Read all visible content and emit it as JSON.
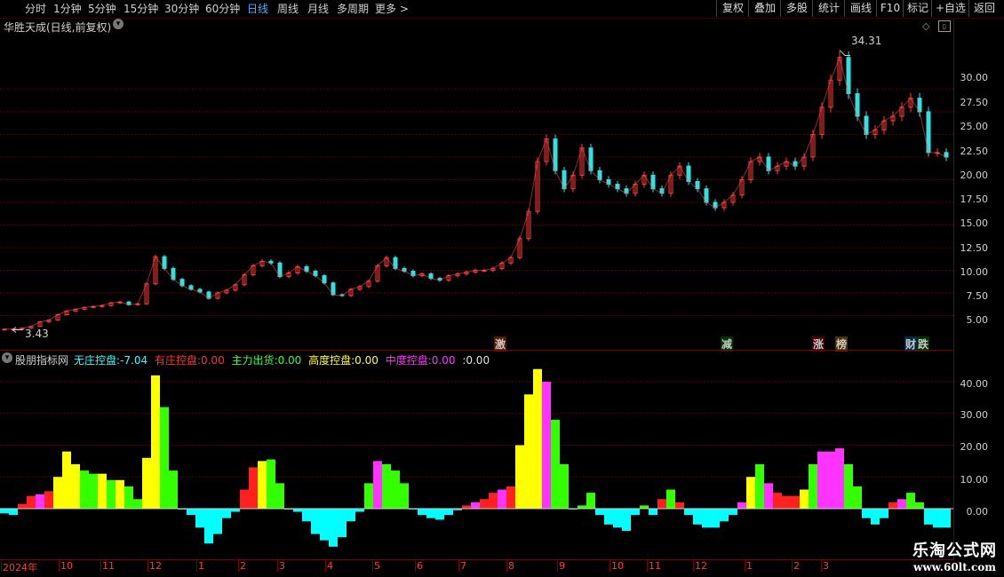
{
  "toolbar": {
    "periods": [
      "分时",
      "1分钟",
      "5分钟",
      "15分钟",
      "30分钟",
      "60分钟",
      "日线",
      "周线",
      "月线",
      "多周期",
      "更多 >"
    ],
    "active_period": "日线",
    "buttons": [
      "复权",
      "叠加",
      "多股",
      "统计",
      "画线",
      "F10",
      "标记",
      "+自选",
      "返回"
    ]
  },
  "main_chart": {
    "title": "华胜天成(日线,前复权)",
    "high_label": "34.31",
    "low_label": "3.43",
    "events": [
      {
        "text": "激",
        "color": "#ff6a00"
      },
      {
        "text": "减",
        "color": "#33ff33"
      },
      {
        "text": "涨",
        "color": "#ff3333"
      },
      {
        "text": "榜",
        "color": "#ffcc33"
      },
      {
        "text": "财",
        "color": "#33aaff"
      },
      {
        "text": "跌",
        "color": "#33ff33"
      }
    ],
    "y_ticks": [
      "30.00",
      "27.50",
      "25.00",
      "22.50",
      "20.00",
      "17.50",
      "15.00",
      "12.50",
      "10.00",
      "7.50",
      "5.00"
    ]
  },
  "indicator": {
    "name": "股朋指标网",
    "items": [
      {
        "label": "无庄控盘:",
        "value": "-7.04",
        "color": "#33ffff"
      },
      {
        "label": "有庄控盘:",
        "value": "0.00",
        "color": "#ff3333"
      },
      {
        "label": "主力出货:",
        "value": "0.00",
        "color": "#33ff33"
      },
      {
        "label": "高度控盘:",
        "value": "0.00",
        "color": "#ffff33"
      },
      {
        "label": "中度控盘:",
        "value": "0.00",
        "color": "#ff33ff"
      },
      {
        "label": ":",
        "value": "0.00",
        "color": "#e0e0e0"
      }
    ],
    "y_ticks": [
      "40.00",
      "30.00",
      "20.00",
      "10.00",
      "0.00"
    ]
  },
  "x_axis": {
    "labels": [
      "2024年",
      "10",
      "11",
      "12",
      "1",
      "2",
      "3",
      "4",
      "5",
      "6",
      "7",
      "8",
      "9",
      "10",
      "11",
      "12",
      "1",
      "2",
      "3"
    ]
  },
  "watermark": {
    "line1": "乐淘公式网",
    "line2": "www.60lt.com"
  },
  "chart_data": [
    {
      "type": "line",
      "title": "华胜天成(日线,前复权)",
      "ylim": [
        2.5,
        37
      ],
      "x": [
        0,
        10,
        20,
        30,
        40,
        50,
        60,
        70,
        80,
        90,
        100,
        110,
        120,
        130,
        140,
        150,
        160,
        170,
        180,
        190,
        200,
        210,
        220,
        230,
        240,
        250,
        260,
        270,
        280,
        290,
        300,
        310,
        320,
        330,
        340,
        350,
        360,
        370,
        380,
        390,
        400,
        410,
        420,
        430,
        440,
        450,
        460,
        470,
        480,
        490,
        500,
        510,
        520,
        530,
        540,
        550,
        560,
        570,
        580,
        590,
        600,
        610,
        620,
        630,
        640,
        650,
        660,
        670,
        680,
        690,
        700,
        710,
        720,
        730,
        740,
        750,
        760,
        770,
        780,
        790,
        800,
        810,
        820,
        830,
        840,
        850,
        860,
        870,
        880,
        890,
        900,
        910,
        920,
        930,
        940,
        950,
        960,
        970,
        980,
        990,
        1000,
        1010,
        1020,
        1030,
        1040,
        1050,
        1060
      ],
      "values": [
        3.5,
        3.5,
        3.6,
        3.8,
        4.3,
        4.5,
        5.1,
        5.5,
        5.7,
        5.9,
        6.0,
        6.1,
        6.4,
        6.5,
        6.2,
        6.3,
        8.5,
        11.5,
        10.2,
        9.0,
        8.3,
        7.9,
        7.6,
        6.9,
        7.5,
        7.8,
        8.4,
        9.5,
        10.5,
        11.0,
        10.8,
        9.3,
        9.7,
        10.4,
        9.9,
        9.4,
        8.6,
        7.3,
        7.2,
        7.9,
        8.2,
        8.8,
        10.5,
        11.4,
        10.2,
        9.9,
        9.4,
        9.6,
        9.1,
        8.9,
        9.4,
        9.6,
        9.8,
        10.0,
        10.0,
        10.2,
        10.8,
        11.4,
        13.5,
        16.5,
        22.0,
        24.5,
        21.0,
        19.0,
        20.5,
        23.5,
        21.0,
        20.0,
        19.5,
        19.0,
        18.5,
        19.5,
        20.5,
        19.0,
        18.5,
        20.5,
        21.5,
        19.8,
        19.0,
        17.5,
        16.9,
        17.5,
        18.3,
        20.0,
        22.0,
        22.5,
        21.0,
        21.5,
        22.0,
        21.5,
        22.5,
        25.0,
        28.0,
        31.0,
        33.5,
        29.5,
        27.0,
        25.0,
        25.5,
        26.5,
        27.0,
        28.0,
        29.0,
        27.5,
        23.0,
        23.0,
        22.5
      ],
      "high": 34.31,
      "low": 3.43,
      "y_ticks": [
        30,
        27.5,
        25,
        22.5,
        20,
        17.5,
        15,
        12.5,
        10,
        7.5,
        5
      ]
    },
    {
      "type": "bar",
      "title": "股朋指标网",
      "ylim": [
        -14,
        47
      ],
      "x": [
        0,
        10,
        20,
        30,
        40,
        50,
        60,
        70,
        80,
        90,
        100,
        110,
        120,
        130,
        140,
        150,
        160,
        170,
        180,
        190,
        200,
        210,
        220,
        230,
        240,
        250,
        260,
        270,
        280,
        290,
        300,
        310,
        320,
        330,
        340,
        350,
        360,
        370,
        380,
        390,
        400,
        410,
        420,
        430,
        440,
        450,
        460,
        470,
        480,
        490,
        500,
        510,
        520,
        530,
        540,
        550,
        560,
        570,
        580,
        590,
        600,
        610,
        620,
        630,
        640,
        650,
        660,
        670,
        680,
        690,
        700,
        710,
        720,
        730,
        740,
        750,
        760,
        770,
        780,
        790,
        800,
        810,
        820,
        830,
        840,
        850,
        860,
        870,
        880,
        890,
        900,
        910,
        920,
        930,
        940,
        950,
        960,
        970,
        980,
        990,
        1000,
        1010,
        1020,
        1030,
        1040,
        1050,
        1060
      ],
      "values": [
        -1.5,
        -2.0,
        1.5,
        4.0,
        4.5,
        5.5,
        10.0,
        18.0,
        14.0,
        12.0,
        11.0,
        11.0,
        9.0,
        9.0,
        7.0,
        3.0,
        16.0,
        42.0,
        32.0,
        12.0,
        0,
        -2.0,
        -6.0,
        -11.0,
        -8.0,
        -3.0,
        -1.0,
        6.0,
        13.0,
        15.0,
        15.5,
        8.0,
        0,
        -1.0,
        -4.0,
        -8.0,
        -10.0,
        -12.0,
        -9.0,
        -4.0,
        -1.0,
        8.0,
        15.0,
        14.0,
        12.0,
        8.0,
        0,
        -2.0,
        -3.0,
        -3.5,
        -2.0,
        -0.5,
        1.0,
        2.0,
        3.0,
        5.0,
        6.0,
        7.0,
        20.0,
        36.0,
        44.0,
        40.0,
        28.0,
        14.0,
        0,
        1.0,
        5.0,
        -2.0,
        -5.0,
        -6.0,
        -7.0,
        -2.0,
        1.0,
        -2.0,
        3.0,
        6.0,
        2.0,
        -2.0,
        -5.0,
        -6.0,
        -6.0,
        -4.0,
        -2.0,
        2.0,
        10.0,
        14.0,
        8.0,
        5.0,
        4.0,
        4.0,
        6.0,
        14.0,
        18.0,
        18.0,
        19.0,
        14.0,
        7.0,
        -3.0,
        -5.0,
        -3.0,
        2.0,
        3.0,
        5.0,
        2.0,
        -5.0,
        -6.0,
        -6.0
      ],
      "colors": [
        "cyan",
        "cyan",
        "red",
        "red",
        "magenta",
        "red",
        "yellow",
        "yellow",
        "yellow",
        "green",
        "green",
        "yellow",
        "green",
        "yellow",
        "green",
        "green",
        "yellow",
        "yellow",
        "green",
        "green",
        "cyan",
        "cyan",
        "cyan",
        "cyan",
        "cyan",
        "cyan",
        "cyan",
        "red",
        "red",
        "yellow",
        "green",
        "green",
        "cyan",
        "cyan",
        "cyan",
        "cyan",
        "cyan",
        "cyan",
        "cyan",
        "cyan",
        "cyan",
        "green",
        "magenta",
        "green",
        "green",
        "green",
        "cyan",
        "cyan",
        "cyan",
        "cyan",
        "cyan",
        "cyan",
        "red",
        "magenta",
        "red",
        "red",
        "magenta",
        "red",
        "yellow",
        "yellow",
        "yellow",
        "magenta",
        "green",
        "green",
        "cyan",
        "green",
        "green",
        "cyan",
        "cyan",
        "cyan",
        "cyan",
        "cyan",
        "green",
        "cyan",
        "red",
        "green",
        "red",
        "cyan",
        "cyan",
        "cyan",
        "cyan",
        "cyan",
        "cyan",
        "magenta",
        "yellow",
        "green",
        "magenta",
        "red",
        "red",
        "red",
        "yellow",
        "green",
        "magenta",
        "magenta",
        "magenta",
        "green",
        "green",
        "cyan",
        "cyan",
        "cyan",
        "red",
        "magenta",
        "green",
        "green",
        "cyan",
        "cyan",
        "cyan"
      ],
      "series_names": [
        "无庄控盘",
        "有庄控盘",
        "主力出货",
        "高度控盘",
        "中度控盘"
      ],
      "y_ticks": [
        40,
        30,
        20,
        10,
        0
      ]
    }
  ]
}
